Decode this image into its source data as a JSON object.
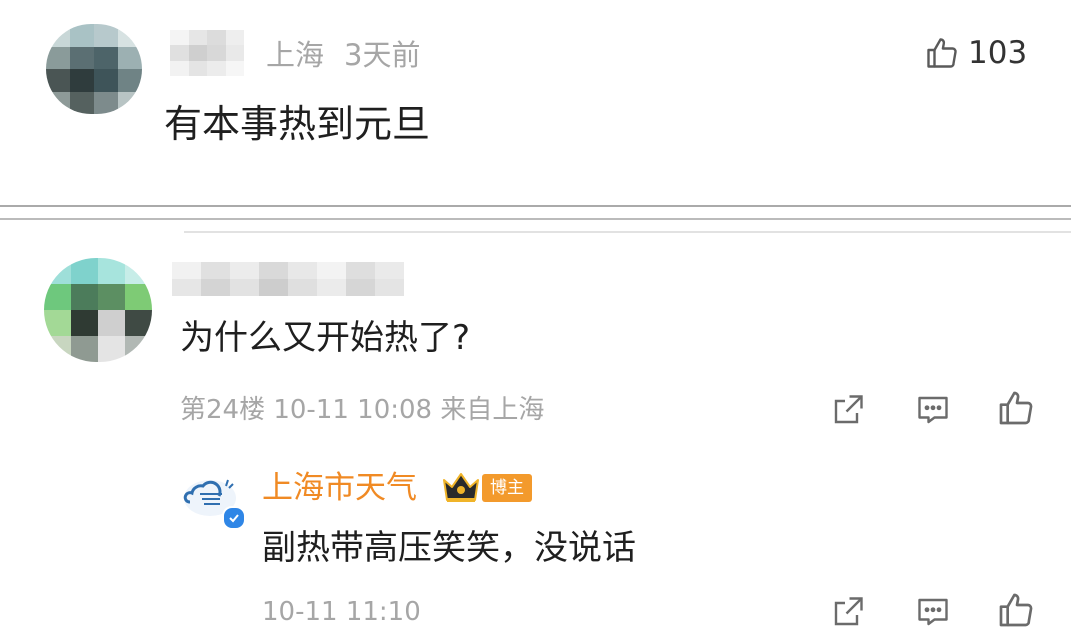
{
  "comment1": {
    "username": "",
    "location": "上海",
    "time_ago": "3天前",
    "likes": "103",
    "text": "有本事热到元旦"
  },
  "comment2": {
    "username": "",
    "text": "为什么又开始热了?",
    "meta": "第24楼 10-11 10:08 来自上海"
  },
  "reply": {
    "name": "上海市天气",
    "badge": "博主",
    "text": "副热带高压笑笑，没说话",
    "time": "10-11 11:10",
    "name_color": "#f08a24",
    "badge_color": "#f39a2c"
  },
  "icons": [
    "thumb-up-icon",
    "share-icon",
    "comment-icon",
    "crown-icon",
    "verified-icon"
  ]
}
